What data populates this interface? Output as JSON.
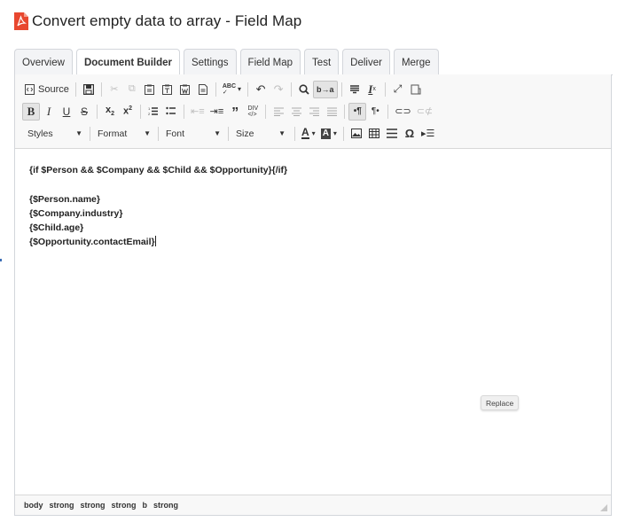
{
  "page": {
    "title": "Convert empty data to array - Field Map"
  },
  "tabs": [
    {
      "label": "Overview"
    },
    {
      "label": "Document Builder"
    },
    {
      "label": "Settings"
    },
    {
      "label": "Field Map"
    },
    {
      "label": "Test"
    },
    {
      "label": "Deliver"
    },
    {
      "label": "Merge"
    }
  ],
  "toolbar": {
    "source_label": "Source",
    "styles_label": "Styles",
    "format_label": "Format",
    "font_label": "Font",
    "size_label": "Size"
  },
  "content": {
    "lines": [
      "{if $Person && $Company && $Child && $Opportunity}{/if}",
      "{$Person.name}",
      "{$Company.industry}",
      "{$Child.age}",
      "{$Opportunity.contactEmail}"
    ]
  },
  "replace_button": {
    "label": "Replace"
  },
  "statusbar": {
    "path": [
      "body",
      "strong",
      "strong",
      "strong",
      "b",
      "strong"
    ]
  },
  "colors": {
    "pdf_icon": "#e8472f",
    "accent": "#3b6db5"
  }
}
